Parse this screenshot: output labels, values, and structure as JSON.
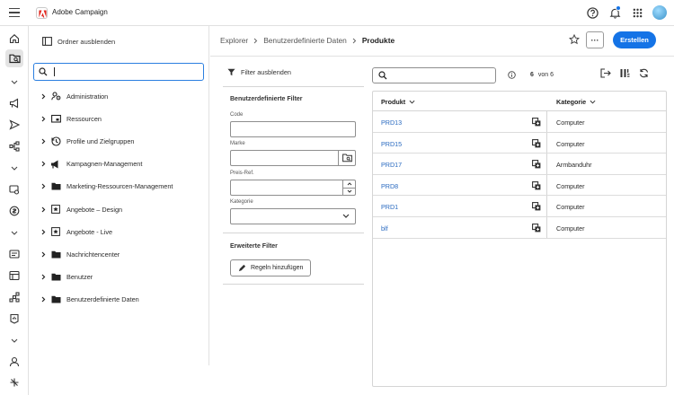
{
  "app": {
    "title": "Adobe Campaign"
  },
  "tree": {
    "hide_label": "Ordner ausblenden",
    "search_value": "",
    "items": [
      {
        "label": "Administration",
        "icon": "admin-icon"
      },
      {
        "label": "Ressourcen",
        "icon": "resources-icon"
      },
      {
        "label": "Profile und Zielgruppen",
        "icon": "profiles-icon"
      },
      {
        "label": "Kampagnen-Management",
        "icon": "megaphone-icon"
      },
      {
        "label": "Marketing-Ressourcen-Management",
        "icon": "folder-icon"
      },
      {
        "label": "Angebote – Design",
        "icon": "offer-icon"
      },
      {
        "label": "Angebote - Live",
        "icon": "offer-icon"
      },
      {
        "label": "Nachrichtencenter",
        "icon": "folder-icon"
      },
      {
        "label": "Benutzer",
        "icon": "folder-icon"
      },
      {
        "label": "Benutzerdefinierte Daten",
        "icon": "folder-icon"
      }
    ]
  },
  "header": {
    "breadcrumb": [
      "Explorer",
      "Benutzerdefinierte Daten",
      "Produkte"
    ],
    "more_label": "···",
    "create_label": "Erstellen"
  },
  "filters": {
    "toggle_label": "Filter ausblenden",
    "custom_heading": "Benutzerdefinierte Filter",
    "fields": [
      {
        "label": "Code",
        "value": ""
      },
      {
        "label": "Marke",
        "value": ""
      },
      {
        "label": "Preis-Ref.",
        "value": ""
      },
      {
        "label": "Kategorie",
        "value": ""
      }
    ],
    "advanced_heading": "Erweiterte Filter",
    "rules_button": "Regeln hinzufügen"
  },
  "grid": {
    "search_value": "",
    "count_value": "6",
    "count_suffix": "von 6",
    "columns": [
      "Produkt",
      "Kategorie"
    ],
    "rows": [
      {
        "name": "PRD13",
        "category": "Computer"
      },
      {
        "name": "PRD15",
        "category": "Computer"
      },
      {
        "name": "PRD17",
        "category": "Armbanduhr"
      },
      {
        "name": "PRD8",
        "category": "Computer"
      },
      {
        "name": "PRD1",
        "category": "Computer"
      },
      {
        "name": "blf",
        "category": "Computer"
      }
    ]
  },
  "colors": {
    "accent": "#1473e6",
    "link": "#2a6ac0"
  }
}
